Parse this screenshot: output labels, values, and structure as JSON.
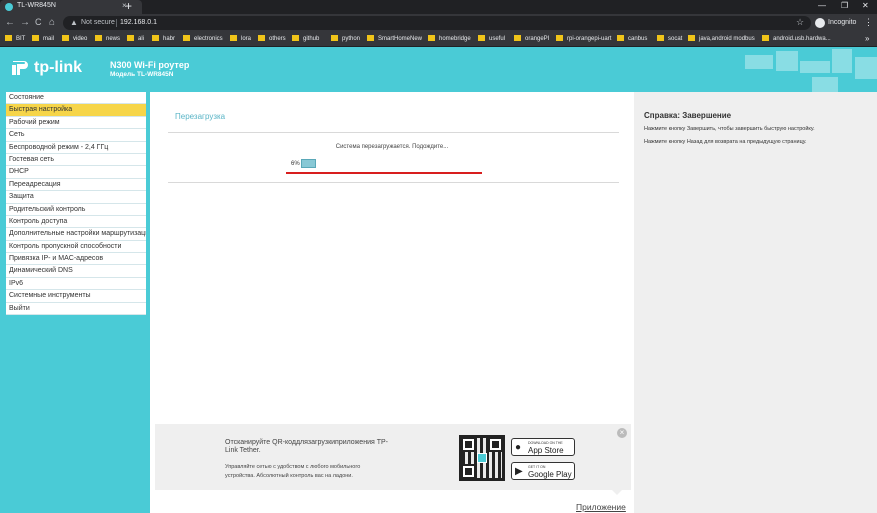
{
  "browser": {
    "tab_title": "TL-WR845N",
    "tab_close": "×",
    "new_tab": "+",
    "window_controls": [
      "—",
      "❐",
      "✕"
    ],
    "nav": {
      "back": "←",
      "forward": "→",
      "reload": "C",
      "home": "⌂"
    },
    "security_label": "Not secure",
    "url": "192.168.0.1",
    "profile_label": "Incognito",
    "menu": "⋮",
    "bookmarks": [
      "BIT",
      "mail",
      "video",
      "news",
      "ali",
      "habr",
      "electronics",
      "lora",
      "others",
      "github",
      "python",
      "SmartHomeNew",
      "homebridge",
      "useful",
      "orangePI",
      "rpi-orangepi-uart",
      "canbus",
      "socat",
      "java,android modbus",
      "android.usb.hardwa..."
    ],
    "bookmarks_more": "»",
    "colors": {
      "chrome_dark": "#202124",
      "chrome_mid": "#35363a",
      "folder": "#f0c419"
    }
  },
  "router": {
    "logo": "tp-link",
    "product_name": "N300 Wi-Fi роутер",
    "model_label": "Модель TL-WR845N",
    "colors": {
      "brand": "#4acbd6",
      "active_menu": "#f6d549",
      "progress_line": "#d81e1e"
    }
  },
  "sidebar": {
    "items": [
      {
        "label": "Состояние"
      },
      {
        "label": "Быстрая настройка",
        "active": true
      },
      {
        "label": "Рабочий режим"
      },
      {
        "label": "Сеть"
      },
      {
        "label": "Беспроводной режим - 2,4 ГГц"
      },
      {
        "label": "Гостевая сеть"
      },
      {
        "label": "DHCP"
      },
      {
        "label": "Переадресация"
      },
      {
        "label": "Защита"
      },
      {
        "label": "Родительский контроль"
      },
      {
        "label": "Контроль доступа"
      },
      {
        "label": "Дополнительные настройки маршрутизации"
      },
      {
        "label": "Контроль пропускной способности"
      },
      {
        "label": "Привязка IP- и MAC-адресов"
      },
      {
        "label": "Динамический DNS"
      },
      {
        "label": "IPv6"
      },
      {
        "label": "Системные инструменты"
      },
      {
        "label": "Выйти"
      }
    ]
  },
  "main": {
    "section_title": "Перезагрузка",
    "status_message": "Система перезагружается. Подождите...",
    "progress_label": "6%",
    "progress_fraction": 0.06
  },
  "banner": {
    "title": "Отсканируйте QR-коддлязагрузкиприложения TP-Link Tether.",
    "subtitle": "Управляйте сетью с удобством с любого мобильного устройства. Абсолютный контроль вас на ладони.",
    "app_store": {
      "small": "DOWNLOAD ON THE",
      "big": "App Store"
    },
    "google_play": {
      "small": "GET IT ON",
      "big": "Google Play"
    },
    "close": "×",
    "app_link": "Приложение"
  },
  "help": {
    "title": "Справка: Завершение",
    "lines": [
      "Нажмите кнопку Завершить, чтобы завершить быструю настройку.",
      "Нажмите кнопку Назад для возврата на предыдущую страницу."
    ]
  }
}
